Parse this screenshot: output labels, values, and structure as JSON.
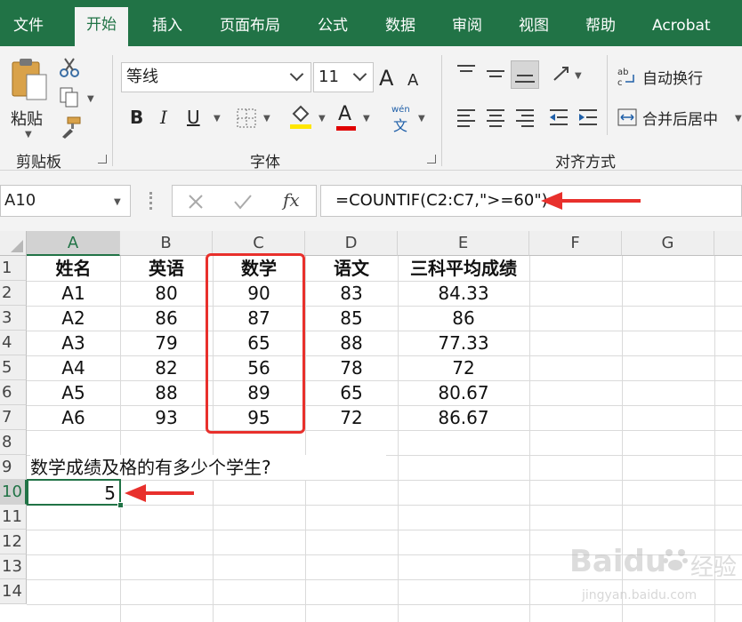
{
  "ribbon_tabs": [
    {
      "label": "文件",
      "active": false
    },
    {
      "label": "开始",
      "active": true
    },
    {
      "label": "插入",
      "active": false
    },
    {
      "label": "页面布局",
      "active": false
    },
    {
      "label": "公式",
      "active": false
    },
    {
      "label": "数据",
      "active": false
    },
    {
      "label": "审阅",
      "active": false
    },
    {
      "label": "视图",
      "active": false
    },
    {
      "label": "帮助",
      "active": false
    },
    {
      "label": "Acrobat",
      "active": false
    }
  ],
  "clipboard": {
    "paste_label": "粘贴",
    "group_label": "剪贴板"
  },
  "font": {
    "name": "等线",
    "size": "11",
    "group_label": "字体",
    "bold": "B",
    "italic": "I",
    "underline": "U",
    "grow": "A",
    "shrink": "A",
    "font_color_letter": "A",
    "phonetic_top": "wén",
    "phonetic_bottom": "文"
  },
  "alignment": {
    "wrap_text": "自动换行",
    "merge_center": "合并后居中",
    "group_label": "对齐方式"
  },
  "formula_bar": {
    "name_box": "A10",
    "formula": "=COUNTIF(C2:C7,\">=60\")",
    "fx": "fx"
  },
  "colors": {
    "excel_green": "#217346",
    "annotation_red": "#e8302c"
  },
  "sheet": {
    "columns": [
      "A",
      "B",
      "C",
      "D",
      "E",
      "F",
      "G"
    ],
    "rows": [
      "1",
      "2",
      "3",
      "4",
      "5",
      "6",
      "7",
      "8",
      "9",
      "10",
      "11",
      "12",
      "13",
      "14"
    ],
    "header": [
      "姓名",
      "英语",
      "数学",
      "语文",
      "三科平均成绩"
    ],
    "data": [
      [
        "A1",
        "80",
        "90",
        "83",
        "84.33"
      ],
      [
        "A2",
        "86",
        "87",
        "85",
        "86"
      ],
      [
        "A3",
        "79",
        "65",
        "88",
        "77.33"
      ],
      [
        "A4",
        "82",
        "56",
        "78",
        "72"
      ],
      [
        "A5",
        "88",
        "89",
        "65",
        "80.67"
      ],
      [
        "A6",
        "93",
        "95",
        "72",
        "86.67"
      ]
    ],
    "question": "数学成绩及格的有多少个学生?",
    "result": "5",
    "selected_cell": "A10"
  },
  "watermark": {
    "brand": "Baidu",
    "text": "经验",
    "url": "jingyan.baidu.com"
  }
}
